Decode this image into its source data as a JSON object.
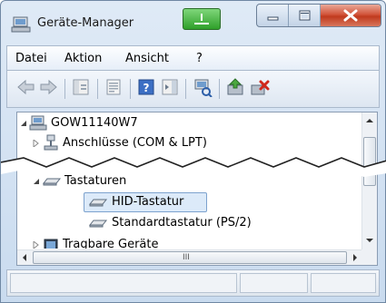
{
  "window": {
    "title": "Geräte-Manager"
  },
  "menu": {
    "items": [
      "Datei",
      "Aktion",
      "Ansicht",
      "?"
    ]
  },
  "toolbar": {
    "buttons": [
      "back-icon",
      "forward-icon",
      "show-hide-console-tree-icon",
      "properties-icon",
      "help-icon",
      "action-pane-icon",
      "scan-hardware-icon",
      "update-driver-icon",
      "uninstall-device-icon"
    ]
  },
  "tree": {
    "root": "GOW11140W7",
    "ports": "Anschlüsse (COM & LPT)",
    "keyboards": "Tastaturen",
    "hid_keyboard": "HID-Tastatur",
    "standard_keyboard": "Standardtastatur (PS/2)",
    "portable_devices": "Tragbare Geräte"
  },
  "scroll": {
    "h_grip": "III"
  },
  "colors": {
    "selection": "#dceaf9",
    "titlebar": "#dfeaf6",
    "close_button": "#c03a1e"
  }
}
